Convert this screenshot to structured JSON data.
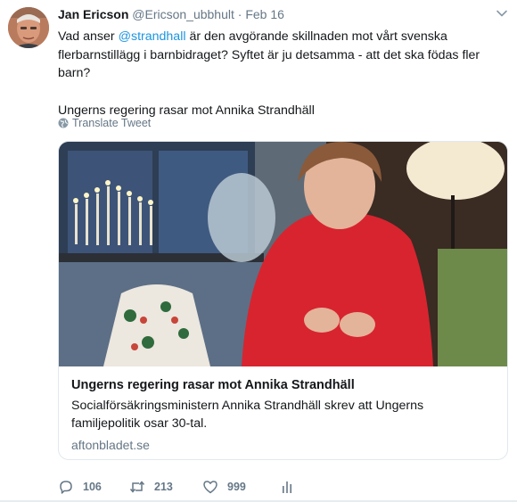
{
  "author": {
    "name": "Jan Ericson",
    "handle": "@Ericson_ubbhult",
    "separator": "·",
    "date": "Feb 16"
  },
  "tweet": {
    "text_before": "Vad anser ",
    "mention": "@strandhall",
    "text_after": " är den avgörande skillnaden mot vårt svenska flerbarnstillägg i barnbidraget? Syftet är ju detsamma - att det ska födas fler barn?",
    "second_line": "Ungerns regering rasar mot Annika Strandhäll"
  },
  "translate_label": "Translate Tweet",
  "card": {
    "title": "Ungerns regering rasar mot Annika Strandhäll",
    "description": "Socialförsäkringsministern Annika Strandhäll skrev att Ungerns familjepolitik osar 30-tal.",
    "domain": "aftonbladet.se"
  },
  "actions": {
    "replies": "106",
    "retweets": "213",
    "likes": "999"
  },
  "colors": {
    "link": "#1b95e0",
    "muted": "#657786",
    "text": "#14171a",
    "border": "#e1e8ed"
  },
  "icons": [
    "avatar",
    "chevron-down-icon",
    "globe-icon",
    "reply-icon",
    "retweet-icon",
    "like-icon",
    "analytics-icon"
  ]
}
